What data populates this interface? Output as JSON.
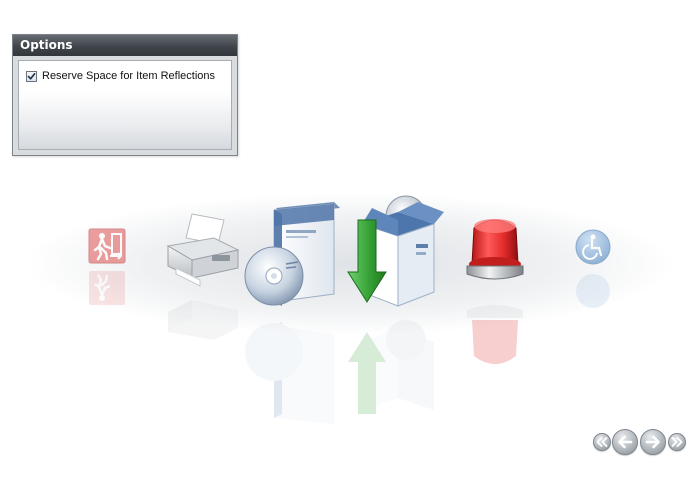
{
  "options": {
    "title": "Options",
    "reserve_reflections_label": "Reserve Space for Item Reflections",
    "reserve_reflections_checked": true
  },
  "carousel": {
    "items": [
      {
        "name": "emergency-exit",
        "icon": "emergency-exit-icon"
      },
      {
        "name": "printer",
        "icon": "printer-icon"
      },
      {
        "name": "software-box-with-cd",
        "icon": "software-box-cd-icon"
      },
      {
        "name": "install-box-download",
        "icon": "install-box-download-icon"
      },
      {
        "name": "red-alarm-beacon",
        "icon": "red-alarm-light-icon"
      },
      {
        "name": "accessibility",
        "icon": "wheelchair-accessibility-icon"
      }
    ]
  },
  "navigation": {
    "buttons": [
      "first-icon",
      "previous-icon",
      "next-icon",
      "last-icon"
    ]
  },
  "colors": {
    "panel_header": "#3f454b",
    "beacon_red": "#e02a2a",
    "arrow_green": "#3aa63a",
    "accessibility_blue": "#6f9fd1",
    "exit_red": "#e05050"
  }
}
